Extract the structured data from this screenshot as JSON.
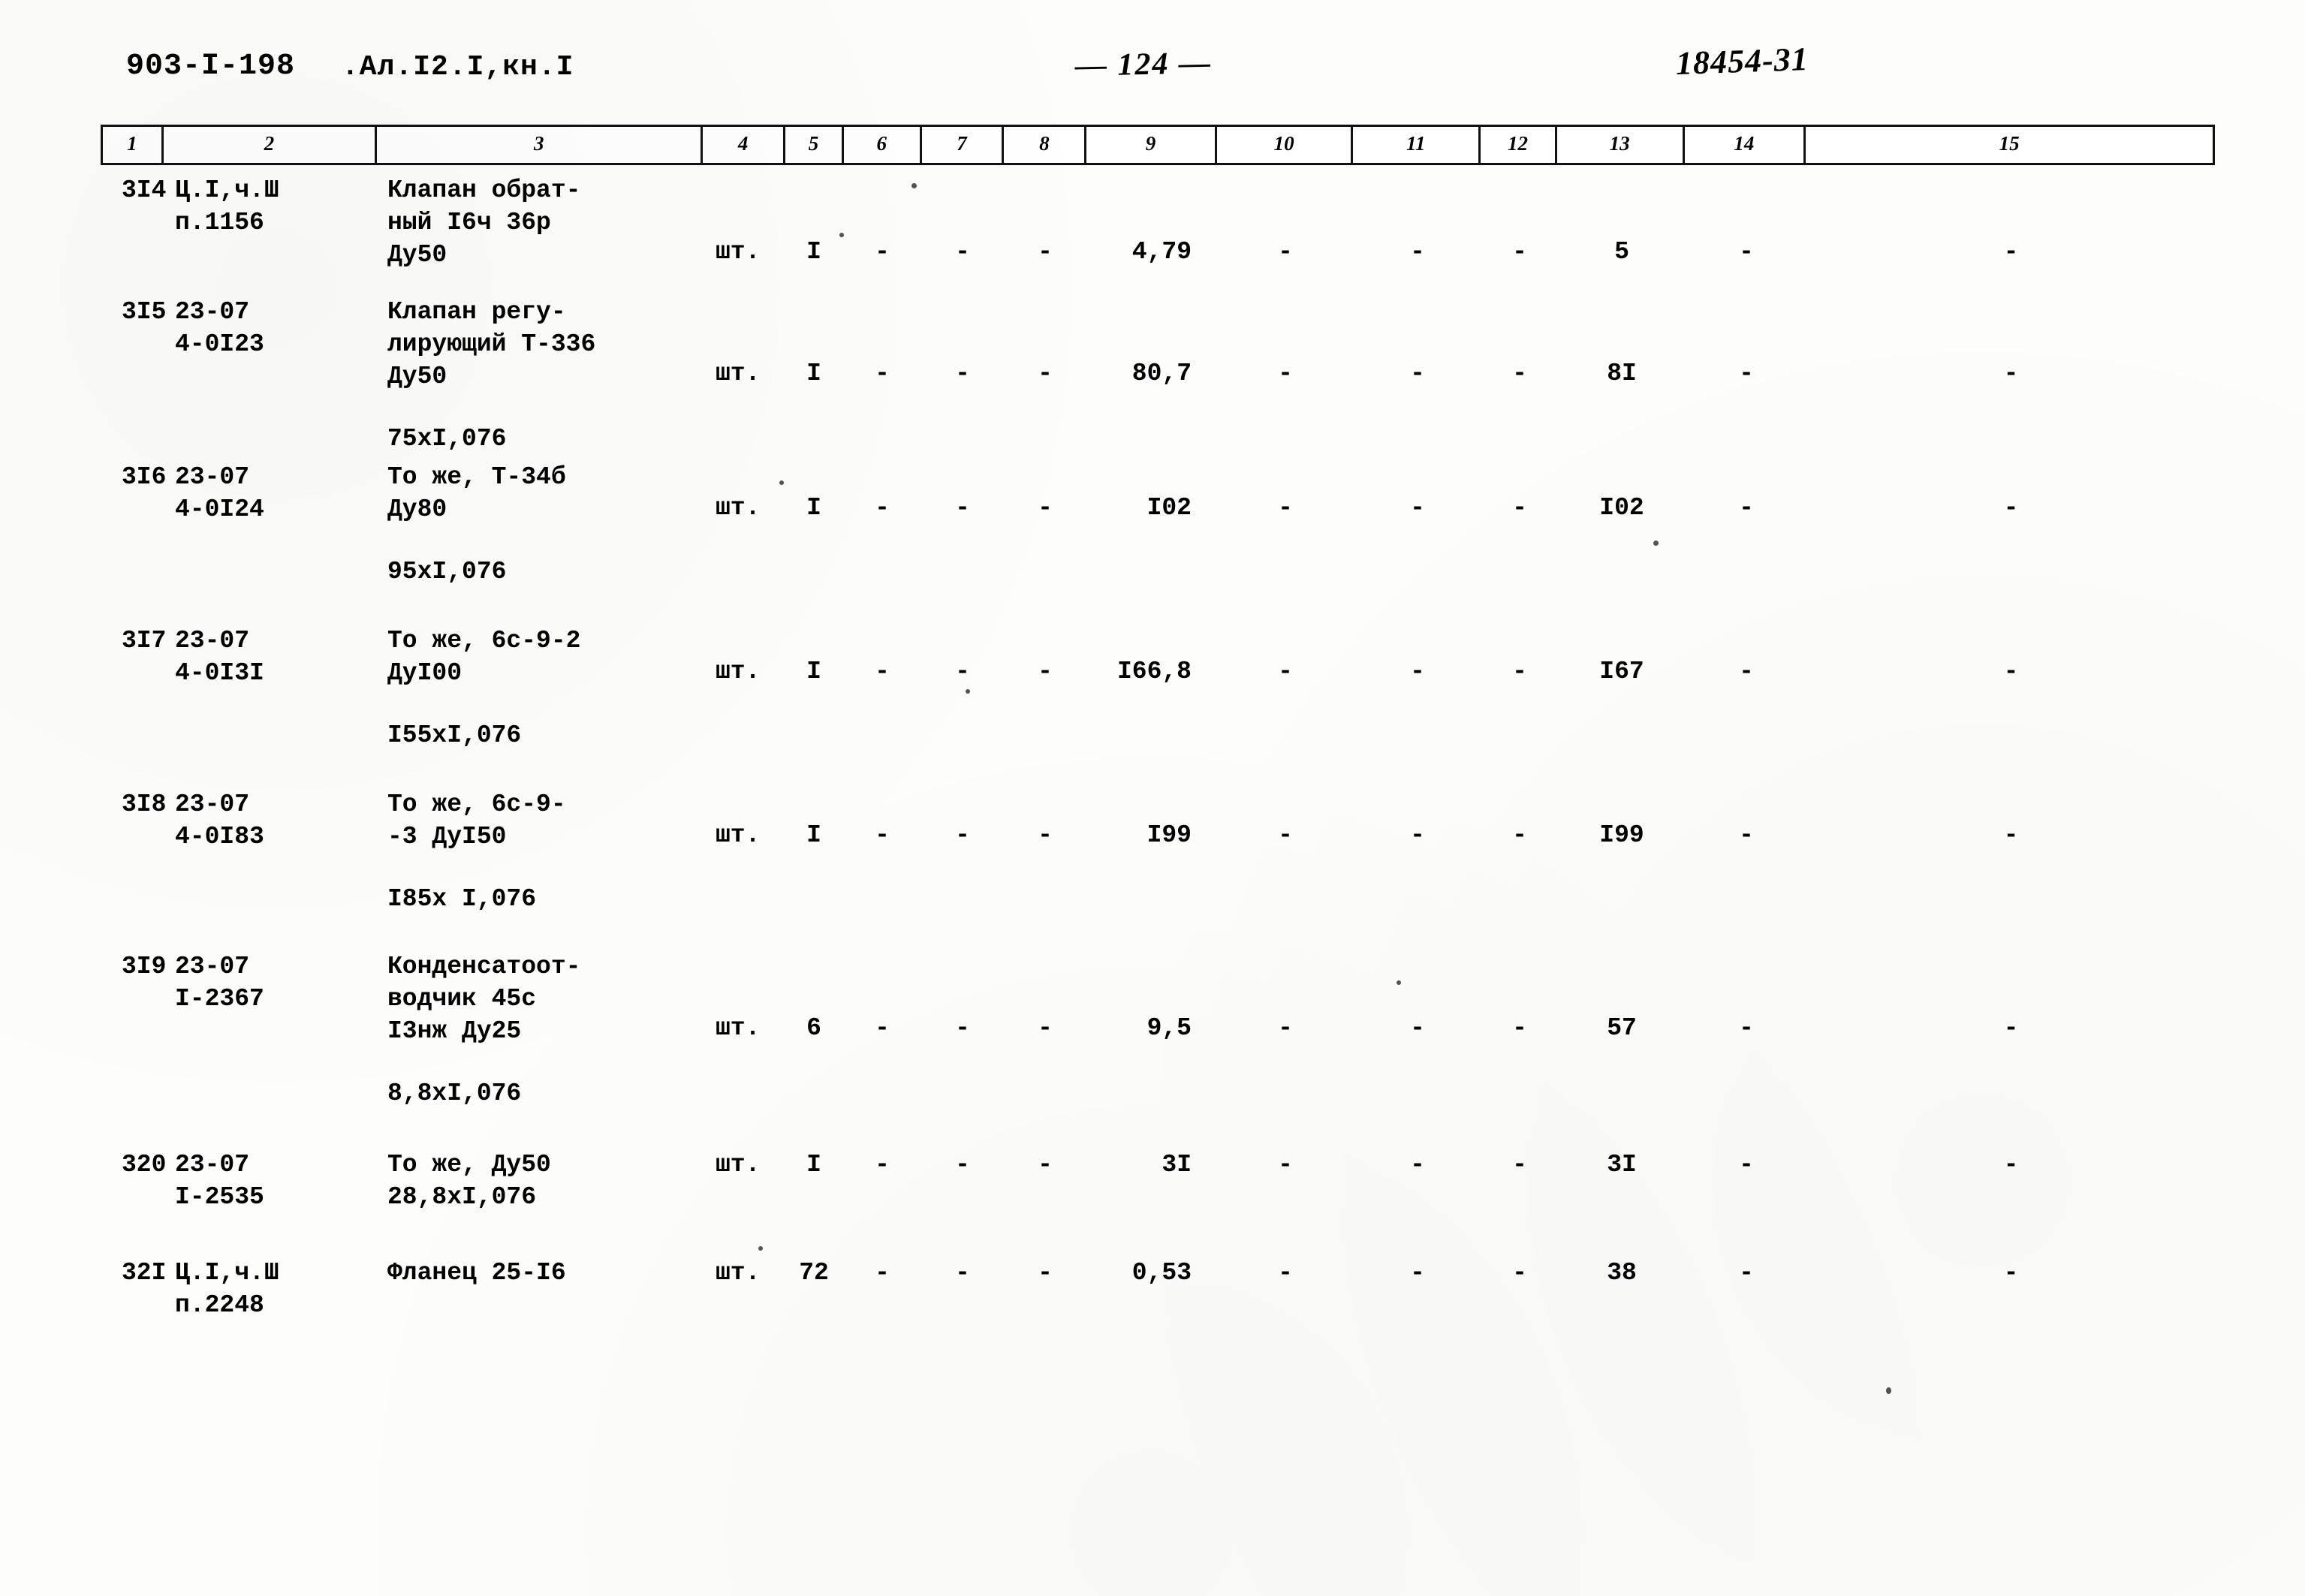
{
  "header": {
    "doc_code": "903-I-198",
    "album_ref": ".Ал.I2.I,кн.I",
    "page_number": "— 124 —",
    "sheet_stamp": "18454-31"
  },
  "table": {
    "column_headers": [
      "1",
      "2",
      "3",
      "4",
      "5",
      "6",
      "7",
      "8",
      "9",
      "10",
      "11",
      "12",
      "13",
      "14",
      "15"
    ],
    "rows": [
      {
        "num": "3I4",
        "code_line1": "Ц.I,ч.Ш",
        "code_line2": "п.1156",
        "name_line1": "Клапан обрат-",
        "name_line2": "ный I6ч 36р",
        "name_line3": "Ду50",
        "name_line4": "",
        "unit": "шт.",
        "qty": "I",
        "c6": "-",
        "c7": "-",
        "c8": "-",
        "c9": "4,79",
        "c10": "-",
        "c11": "-",
        "c12": "-",
        "c13": "5",
        "c14": "-",
        "c15": "-"
      },
      {
        "num": "3I5",
        "code_line1": "23-07",
        "code_line2": "4-0I23",
        "name_line1": "Клапан регу-",
        "name_line2": "лирующий Т-336",
        "name_line3": "Ду50",
        "name_line4": "75xI,076",
        "unit": "шт.",
        "qty": "I",
        "c6": "-",
        "c7": "-",
        "c8": "-",
        "c9": "80,7",
        "c10": "-",
        "c11": "-",
        "c12": "-",
        "c13": "8I",
        "c14": "-",
        "c15": "-"
      },
      {
        "num": "3I6",
        "code_line1": "23-07",
        "code_line2": "4-0I24",
        "name_line1": "То же, Т-34б",
        "name_line2": "Ду80",
        "name_line3": "",
        "name_line4": "95xI,076",
        "unit": "шт.",
        "qty": "I",
        "c6": "-",
        "c7": "-",
        "c8": "-",
        "c9": "I02",
        "c10": "-",
        "c11": "-",
        "c12": "-",
        "c13": "I02",
        "c14": "-",
        "c15": "-"
      },
      {
        "num": "3I7",
        "code_line1": "23-07",
        "code_line2": "4-0I3I",
        "name_line1": "То же, 6с-9-2",
        "name_line2": "ДуI00",
        "name_line3": "",
        "name_line4": "I55xI,076",
        "unit": "шт.",
        "qty": "I",
        "c6": "-",
        "c7": "-",
        "c8": "-",
        "c9": "I66,8",
        "c10": "-",
        "c11": "-",
        "c12": "-",
        "c13": "I67",
        "c14": "-",
        "c15": "-"
      },
      {
        "num": "3I8",
        "code_line1": "23-07",
        "code_line2": "4-0I83",
        "name_line1": "То же, 6с-9-",
        "name_line2": "-3 ДуI50",
        "name_line3": "",
        "name_line4": "I85х I,076",
        "unit": "шт.",
        "qty": "I",
        "c6": "-",
        "c7": "-",
        "c8": "-",
        "c9": "I99",
        "c10": "-",
        "c11": "-",
        "c12": "-",
        "c13": "I99",
        "c14": "-",
        "c15": "-"
      },
      {
        "num": "3I9",
        "code_line1": "23-07",
        "code_line2": "I-2367",
        "name_line1": "Конденсатоот-",
        "name_line2": "водчик 45с",
        "name_line3": "I3нж Ду25",
        "name_line4": "8,8xI,076",
        "unit": "шт.",
        "qty": "6",
        "c6": "-",
        "c7": "-",
        "c8": "-",
        "c9": "9,5",
        "c10": "-",
        "c11": "-",
        "c12": "-",
        "c13": "57",
        "c14": "-",
        "c15": "-"
      },
      {
        "num": "320",
        "code_line1": "23-07",
        "code_line2": "I-2535",
        "name_line1": "То же, Ду50",
        "name_line2": "28,8xI,076",
        "name_line3": "",
        "name_line4": "",
        "unit": "шт.",
        "qty": "I",
        "c6": "-",
        "c7": "-",
        "c8": "-",
        "c9": "3I",
        "c10": "-",
        "c11": "-",
        "c12": "-",
        "c13": "3I",
        "c14": "-",
        "c15": "-"
      },
      {
        "num": "32I",
        "code_line1": "Ц.I,ч.Ш",
        "code_line2": "п.2248",
        "name_line1": "Фланец 25-I6",
        "name_line2": "",
        "name_line3": "",
        "name_line4": "",
        "unit": "шт.",
        "qty": "72",
        "c6": "-",
        "c7": "-",
        "c8": "-",
        "c9": "0,53",
        "c10": "-",
        "c11": "-",
        "c12": "-",
        "c13": "38",
        "c14": "-",
        "c15": "-"
      }
    ]
  }
}
